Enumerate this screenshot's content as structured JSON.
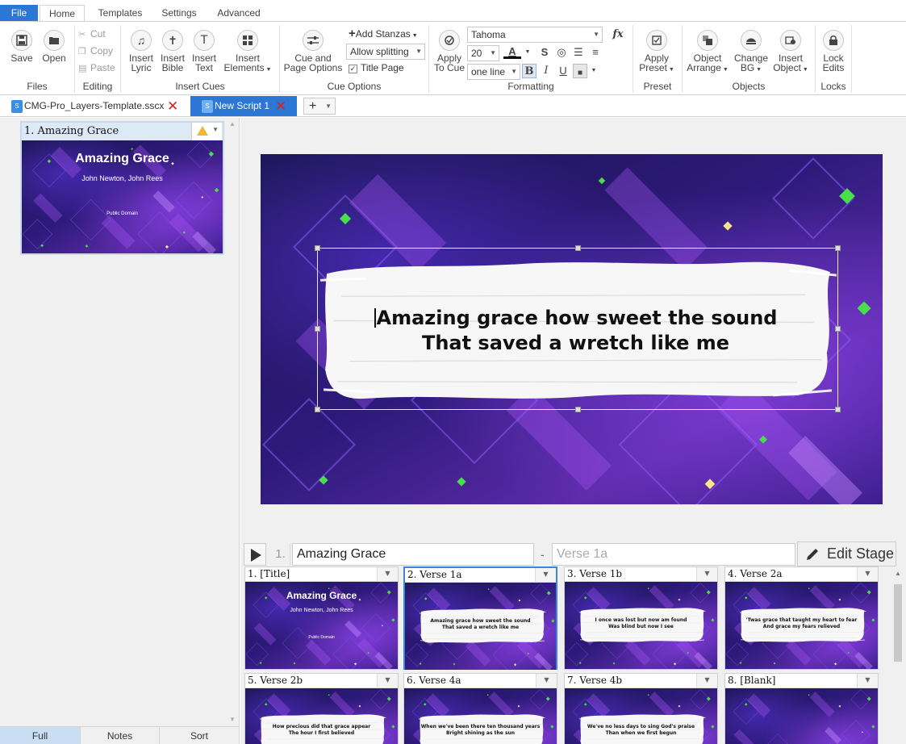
{
  "menu": {
    "tabs": [
      "File",
      "Home",
      "Templates",
      "Settings",
      "Advanced"
    ]
  },
  "ribbon": {
    "save": "Save",
    "open": "Open",
    "files_label": "Files",
    "cut": "Cut",
    "copy": "Copy",
    "paste": "Paste",
    "editing_label": "Editing",
    "insert_lyric": [
      "Insert",
      "Lyric"
    ],
    "insert_bible": [
      "Insert",
      "Bible"
    ],
    "insert_text": [
      "Insert",
      "Text"
    ],
    "insert_elements": [
      "Insert",
      "Elements"
    ],
    "insert_cues_label": "Insert Cues",
    "cue_page_options": [
      "Cue and",
      "Page Options"
    ],
    "add_stanzas": "Add Stanzas",
    "allow_splitting": "Allow splitting",
    "title_page": "Title Page",
    "cue_options_label": "Cue Options",
    "apply_to_cue": [
      "Apply",
      "To Cue"
    ],
    "font_name": "Tahoma",
    "font_size": "20",
    "line_mode": "one line",
    "fx": "fx",
    "formatting_label": "Formatting",
    "apply_preset": [
      "Apply",
      "Preset"
    ],
    "preset_label": "Preset",
    "object_arrange": [
      "Object",
      "Arrange"
    ],
    "change_bg": [
      "Change",
      "BG"
    ],
    "insert_object": [
      "Insert",
      "Object"
    ],
    "objects_label": "Objects",
    "lock_edits": [
      "Lock",
      "Edits"
    ],
    "locks_label": "Locks"
  },
  "documents": {
    "tabs": [
      {
        "name": "CMG-Pro_Layers-Template.sscx",
        "active": false
      },
      {
        "name": "New Script 1",
        "active": true
      }
    ],
    "add_tab": "+"
  },
  "left_panel": {
    "item_title": "1. Amazing Grace",
    "slide_title": "Amazing Grace",
    "slide_authors": "John Newton, John Rees",
    "slide_copyright": "Public Domain",
    "tabs": [
      "Full",
      "Notes",
      "Sort"
    ]
  },
  "stage": {
    "line1": "Amazing grace how sweet the sound",
    "line2": "That saved a wretch like me"
  },
  "cuebar": {
    "number": "1.",
    "title": "Amazing Grace",
    "dash": "-",
    "subtitle_placeholder": "Verse 1a",
    "edit_stage": "Edit Stage"
  },
  "cues": [
    {
      "label": "1. [Title]",
      "kind": "title",
      "title": "Amazing Grace",
      "authors": "John Newton, John Rees",
      "copyright": "Public Domain"
    },
    {
      "label": "2. Verse 1a",
      "kind": "lyric",
      "l1": "Amazing grace how sweet the sound",
      "l2": "That saved a wretch like me",
      "selected": true
    },
    {
      "label": "3. Verse 1b",
      "kind": "lyric",
      "l1": "I once was lost but now am found",
      "l2": "Was blind but now I see"
    },
    {
      "label": "4. Verse 2a",
      "kind": "lyric",
      "l1": "'Twas grace that taught my heart to fear",
      "l2": "And grace my fears relieved"
    },
    {
      "label": "5. Verse 2b",
      "kind": "lyric",
      "l1": "How precious did that grace appear",
      "l2": "The hour I first believed"
    },
    {
      "label": "6. Verse 4a",
      "kind": "lyric",
      "l1": "When we've been there ten thousand years",
      "l2": "Bright shining as the sun"
    },
    {
      "label": "7. Verse 4b",
      "kind": "lyric",
      "l1": "We've no less days to sing God's praise",
      "l2": "Than when we first begun"
    },
    {
      "label": "8. [Blank]",
      "kind": "blank"
    }
  ],
  "colors": {
    "accent": "#2b77d3",
    "close_red": "#d4241c",
    "warning": "#f2b736",
    "bg_dark": "#1a1550",
    "bg_purple": "#5b2aa8",
    "sparkle": "#4ade4a"
  }
}
